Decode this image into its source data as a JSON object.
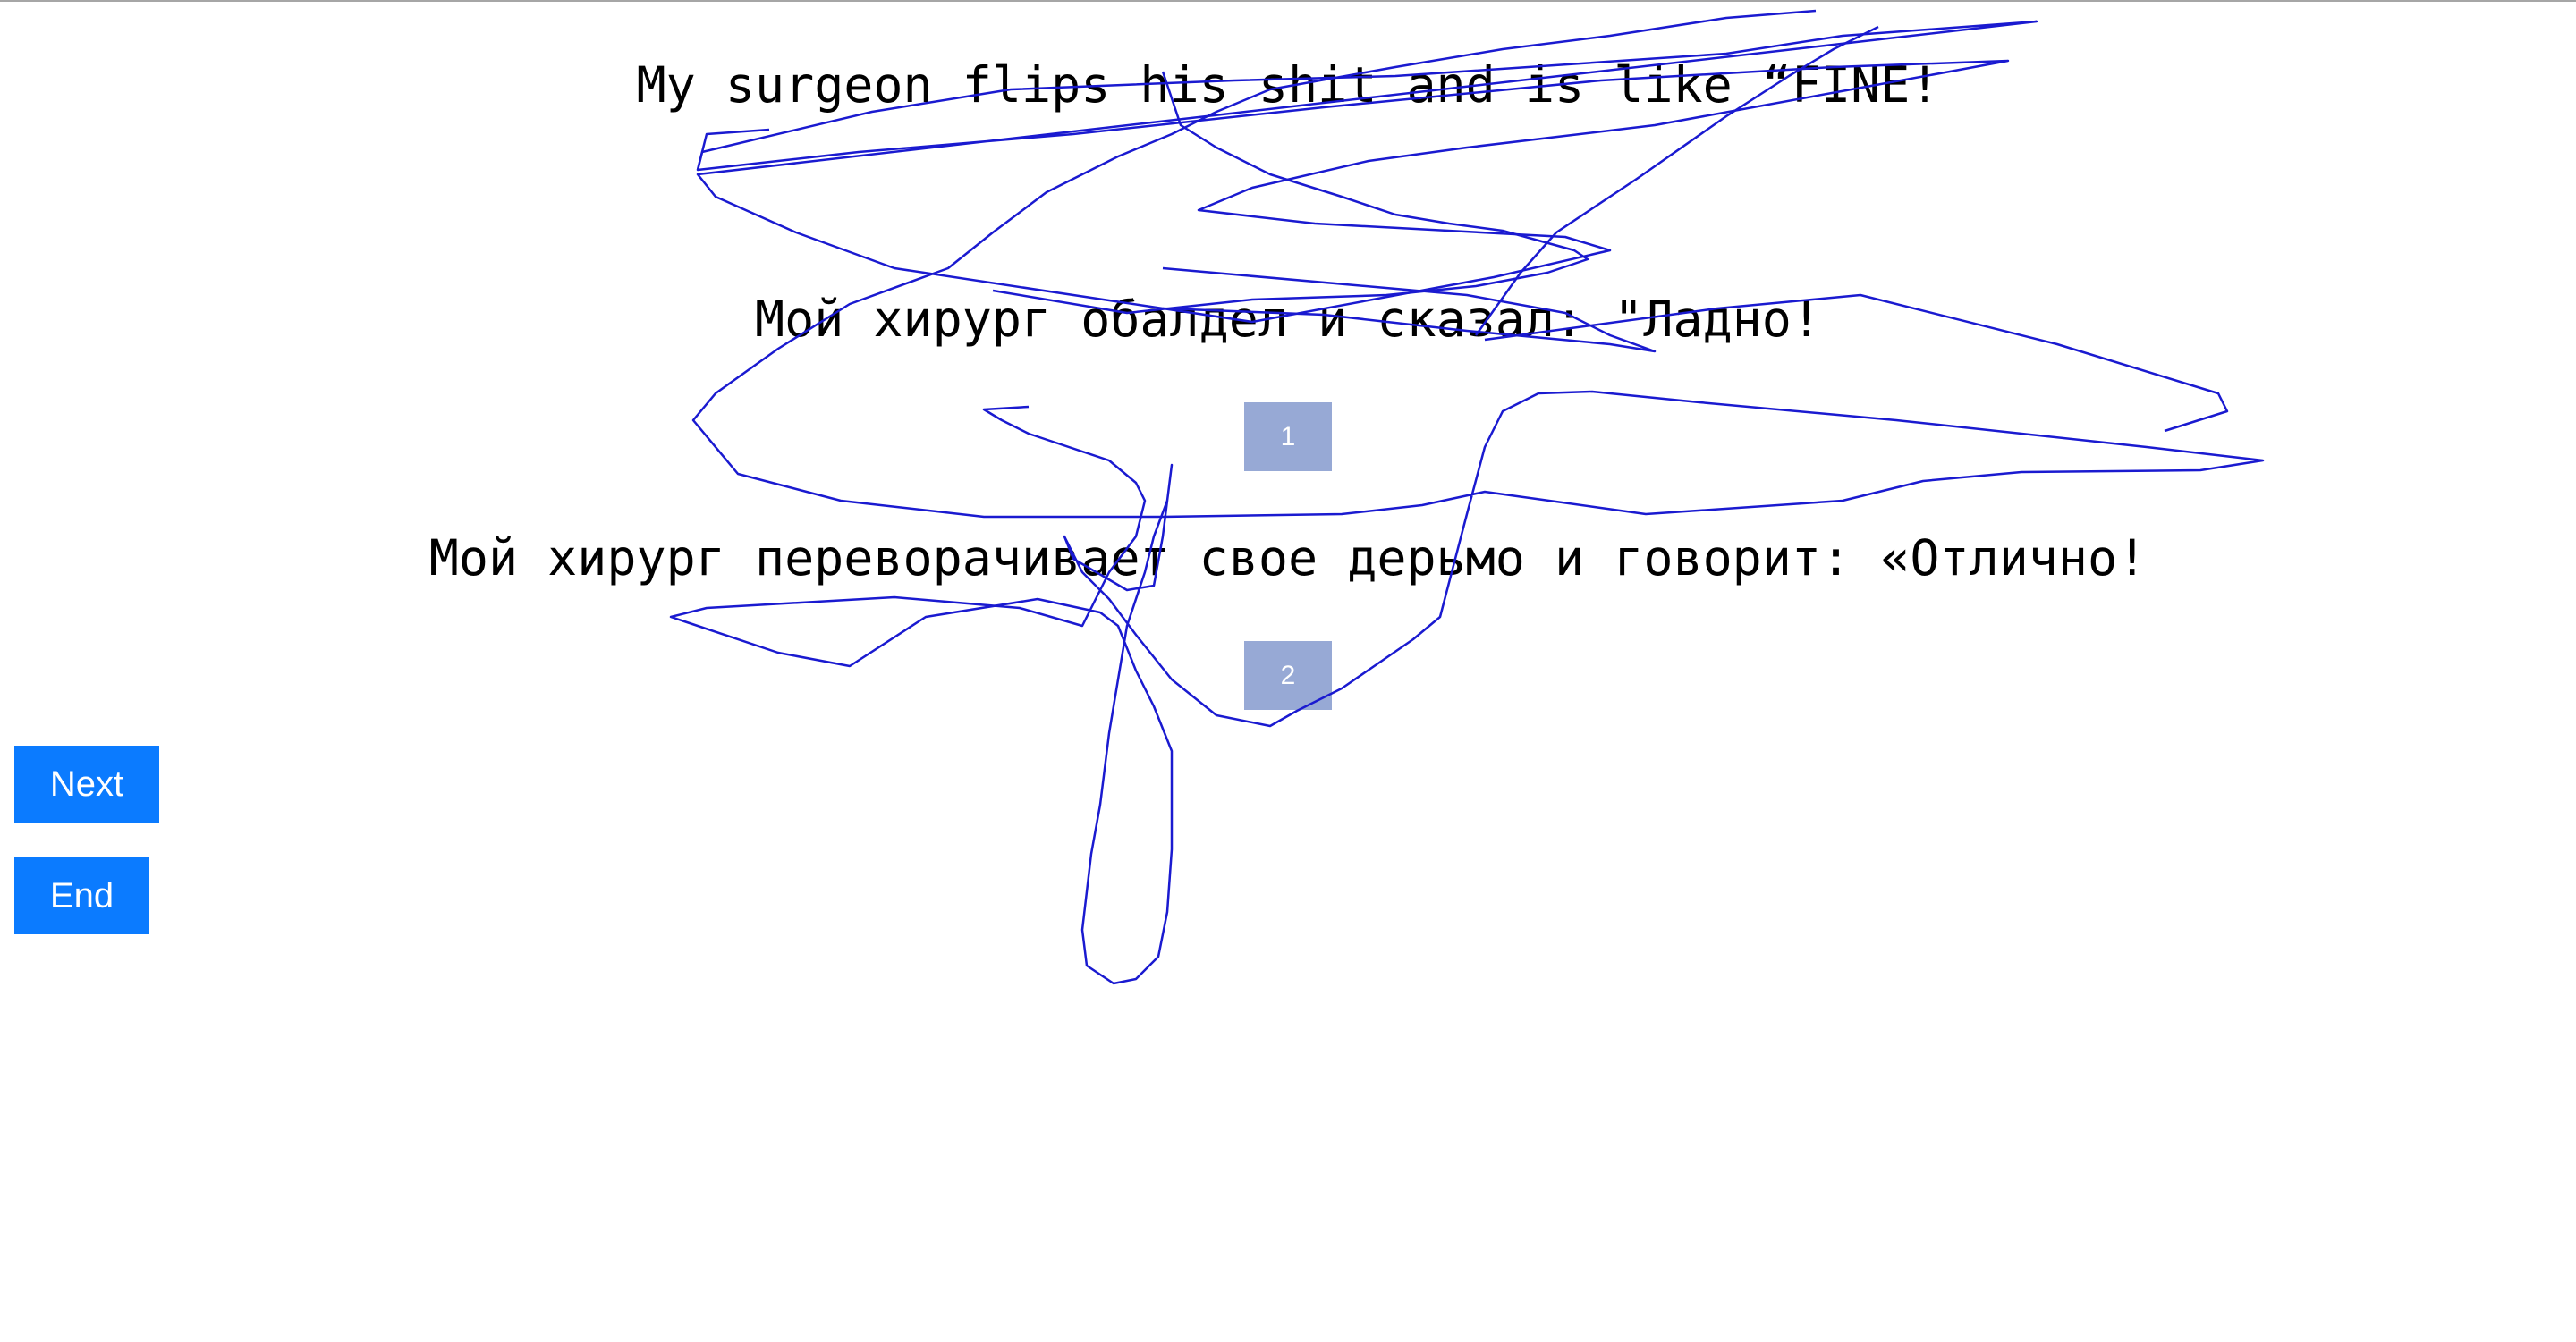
{
  "lines": {
    "source": "My surgeon flips his shit and is like “FINE!",
    "translation_1": "Мой хирург обалдел и сказал: \"Ладно!",
    "translation_2": "Мой хирург переворачивает свое дерьмо и говорит: «Отлично!"
  },
  "choices": {
    "first": "1",
    "second": "2"
  },
  "nav": {
    "next_label": "Next",
    "end_label": "End"
  },
  "colors": {
    "choice_bg": "#97a9d5",
    "nav_bg": "#0b7bff",
    "scribble": "#1a1ad0"
  }
}
